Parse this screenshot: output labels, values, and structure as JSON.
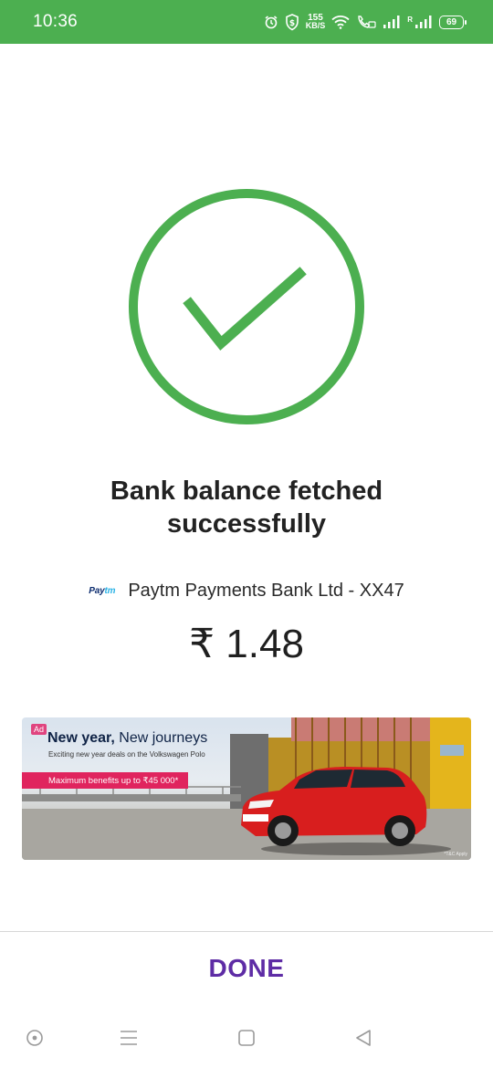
{
  "status_bar": {
    "time": "10:36",
    "net_speed_value": "155",
    "net_speed_unit": "KB/S",
    "roaming": "R",
    "battery": "69",
    "background_color": "#4caf50",
    "icons": [
      "alarm-icon",
      "shield-dollar-icon",
      "wifi-icon",
      "volte-call-icon",
      "signal-icon",
      "signal-roaming-icon",
      "battery-icon"
    ]
  },
  "result": {
    "icon": "success-check-icon",
    "accent_color": "#4caf50",
    "title_line1": "Bank balance fetched",
    "title_line2": "successfully"
  },
  "account": {
    "logo_part1": "Pay",
    "logo_part2": "tm",
    "bank_name": "Paytm Payments Bank Ltd - XX47",
    "balance": "₹ 1.48"
  },
  "ad": {
    "badge": "Ad",
    "headline_bold": "New year,",
    "headline_rest": " New journeys",
    "subtitle": "Exciting new year deals on the Volkswagen Polo",
    "offer": "Maximum benefits up to ₹45 000*",
    "plate": "Polo",
    "note": "*T&C Apply"
  },
  "footer": {
    "done_label": "DONE",
    "done_color": "#5e2ca5"
  },
  "nav_bar": {
    "icons": [
      "assistant-icon",
      "menu-icon",
      "home-icon",
      "back-icon"
    ]
  }
}
